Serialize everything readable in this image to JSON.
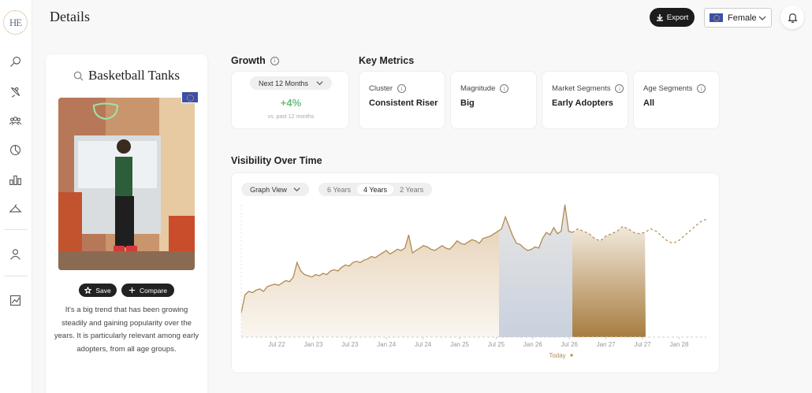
{
  "app": {
    "logo_text": "HE"
  },
  "sidebar": {
    "items": [
      {
        "name": "search-icon"
      },
      {
        "name": "satellite-icon"
      },
      {
        "name": "audience-icon"
      },
      {
        "name": "pie-chart-icon"
      },
      {
        "name": "bar-chart-icon"
      },
      {
        "name": "hanger-icon"
      },
      {
        "name": "user-icon"
      },
      {
        "name": "report-icon"
      }
    ]
  },
  "header": {
    "title": "Details",
    "export_label": "Export",
    "gender_value": "Female"
  },
  "trend": {
    "title": "Basketball Tanks",
    "save_label": "Save",
    "compare_label": "Compare",
    "description": "It's a big trend that has been growing steadily and gaining popularity over the years. It is particularly relevant among early adopters, from all age groups."
  },
  "growth": {
    "title": "Growth",
    "period": "Next 12 Months",
    "value": "+4%",
    "subtitle": "vs. past 12 months"
  },
  "key_metrics": {
    "title": "Key Metrics",
    "items": [
      {
        "label": "Cluster",
        "value": "Consistent Riser"
      },
      {
        "label": "Magnitude",
        "value": "Big"
      },
      {
        "label": "Market Segments",
        "value": "Early Adopters"
      },
      {
        "label": "Age Segments",
        "value": "All"
      }
    ]
  },
  "visibility": {
    "title": "Visibility Over Time",
    "view_label": "Graph View",
    "ranges": [
      "6 Years",
      "4 Years",
      "2 Years"
    ],
    "active_range": "4 Years",
    "today_label": "Today"
  },
  "colors": {
    "accent_gold": "#b08a4f",
    "growth_green": "#6bbf7d",
    "forecast_past": "#c9d1de",
    "forecast_future": "#a87c3f"
  },
  "chart_data": {
    "type": "area",
    "x_ticks": [
      "Jul 22",
      "Jan 23",
      "Jul 23",
      "Jan 24",
      "Jul 24",
      "Jan 25",
      "Jul 25",
      "Jan 26",
      "Jul 26",
      "Jan 27",
      "Jul 27",
      "Jan 28"
    ],
    "historical": [
      0.2,
      0.35,
      0.38,
      0.37,
      0.39,
      0.4,
      0.38,
      0.42,
      0.43,
      0.44,
      0.43,
      0.45,
      0.47,
      0.46,
      0.5,
      0.62,
      0.55,
      0.52,
      0.51,
      0.5,
      0.52,
      0.51,
      0.53,
      0.52,
      0.55,
      0.56,
      0.55,
      0.58,
      0.6,
      0.59,
      0.62,
      0.63,
      0.62,
      0.64,
      0.65,
      0.67,
      0.66,
      0.68,
      0.7,
      0.72,
      0.69,
      0.71,
      0.73,
      0.72,
      0.74,
      0.85,
      0.7,
      0.72,
      0.74,
      0.76,
      0.75,
      0.73,
      0.72,
      0.74,
      0.76,
      0.74,
      0.73,
      0.76,
      0.8,
      0.78,
      0.77,
      0.79,
      0.81,
      0.8,
      0.78,
      0.82,
      0.83,
      0.84,
      0.86,
      0.88,
      0.9,
      1.0,
      0.92,
      0.84,
      0.78,
      0.77,
      0.74,
      0.72,
      0.73,
      0.75,
      0.74,
      0.82,
      0.87,
      0.85,
      0.91,
      0.86,
      0.88,
      1.1,
      0.88,
      0.87
    ],
    "forecast": [
      0.87,
      0.9,
      0.88,
      0.86,
      0.82,
      0.8,
      0.84,
      0.86,
      0.88,
      0.92,
      0.9,
      0.87,
      0.86,
      0.87,
      0.9,
      0.88,
      0.84,
      0.8,
      0.78,
      0.8,
      0.84,
      0.88,
      0.92,
      0.96,
      0.98
    ]
  }
}
